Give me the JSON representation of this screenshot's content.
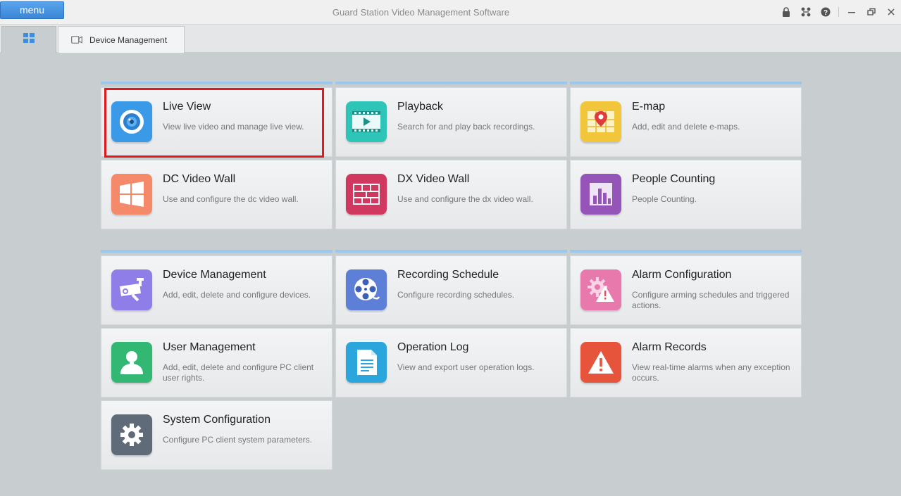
{
  "titlebar": {
    "menu_label": "menu",
    "app_title": "Guard Station Video Management Software",
    "controls": [
      "lock-icon",
      "network-icon",
      "help-icon",
      "minimize-icon",
      "restore-icon",
      "close-icon"
    ]
  },
  "tabs": {
    "home_icon": "grid-icon",
    "device_management_label": "Device Management",
    "device_management_icon": "camera-icon"
  },
  "group1": [
    {
      "title": "Live View",
      "desc": "View live video and manage live view.",
      "icon": "live-view-icon",
      "color": "#3b9ae8",
      "selected": true
    },
    {
      "title": "Playback",
      "desc": "Search for and play back recordings.",
      "icon": "playback-icon",
      "color": "#2fc4b8"
    },
    {
      "title": "E-map",
      "desc": "Add, edit and delete e-maps.",
      "icon": "emap-icon",
      "color": "#f2c63a"
    },
    {
      "title": "DC Video Wall",
      "desc": "Use and configure the dc video wall.",
      "icon": "dc-video-wall-icon",
      "color": "#f58a6a"
    },
    {
      "title": "DX Video Wall",
      "desc": "Use and configure the dx video wall.",
      "icon": "dx-video-wall-icon",
      "color": "#d0385f"
    },
    {
      "title": "People Counting",
      "desc": "People Counting.",
      "icon": "people-counting-icon",
      "color": "#9554b8"
    }
  ],
  "group2": [
    {
      "title": "Device Management",
      "desc": "Add, edit, delete and configure devices.",
      "icon": "device-management-icon",
      "color": "#8f7ee8"
    },
    {
      "title": "Recording Schedule",
      "desc": "Configure recording schedules.",
      "icon": "recording-schedule-icon",
      "color": "#5d7fd8"
    },
    {
      "title": "Alarm Configuration",
      "desc": "Configure arming schedules and triggered actions.",
      "icon": "alarm-configuration-icon",
      "color": "#e879ad"
    },
    {
      "title": "User Management",
      "desc": "Add, edit, delete and configure PC client user rights.",
      "icon": "user-management-icon",
      "color": "#33b874"
    },
    {
      "title": "Operation Log",
      "desc": "View and export user operation logs.",
      "icon": "operation-log-icon",
      "color": "#2aa6dc"
    },
    {
      "title": "Alarm Records",
      "desc": "View real-time alarms when any exception occurs.",
      "icon": "alarm-records-icon",
      "color": "#e7543c"
    },
    {
      "title": "System Configuration",
      "desc": "Configure PC client system parameters.",
      "icon": "system-configuration-icon",
      "color": "#5f6b78"
    }
  ]
}
